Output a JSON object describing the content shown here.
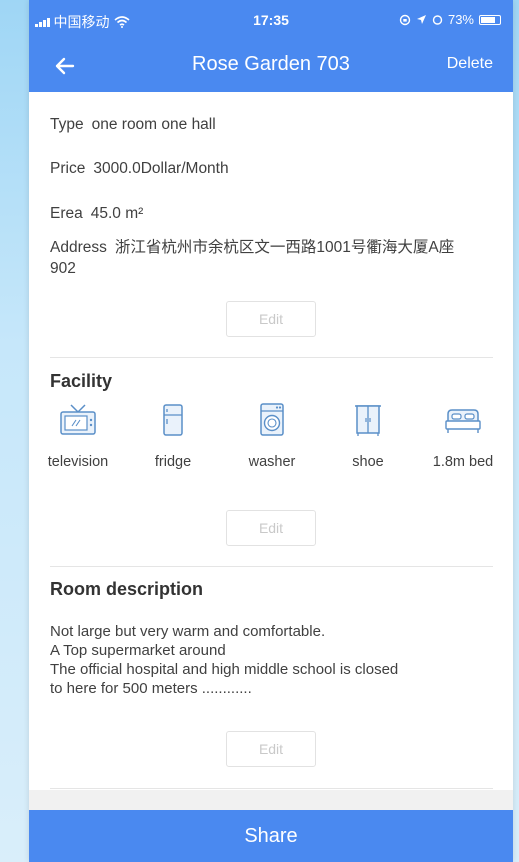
{
  "status_bar": {
    "carrier": "中国移动",
    "time": "17:35",
    "battery": "73%"
  },
  "nav": {
    "title": "Rose Garden 703",
    "delete_label": "Delete"
  },
  "info": {
    "type_label": "Type",
    "type_value": "one room one hall",
    "price_label": "Price",
    "price_value": "3000.0Dollar/Month",
    "area_label": "Erea",
    "area_value": "45.0 m²",
    "address_label": "Address",
    "address_value": "浙江省杭州市余杭区文一西路1001号衢海大厦A座902",
    "edit_label": "Edit"
  },
  "facility": {
    "title": "Facility",
    "items": [
      {
        "label": "television",
        "icon": "television-icon"
      },
      {
        "label": "fridge",
        "icon": "fridge-icon"
      },
      {
        "label": "washer",
        "icon": "washer-icon"
      },
      {
        "label": "shoe",
        "icon": "shoe-cabinet-icon"
      },
      {
        "label": "1.8m bed",
        "icon": "bed-icon"
      }
    ],
    "edit_label": "Edit"
  },
  "description": {
    "title": "Room description",
    "lines": [
      "Not large but very warm and comfortable.",
      "A Top supermarket around",
      "The official hospital and high middle school is closed",
      "to here for 500 meters ............"
    ],
    "edit_label": "Edit"
  },
  "share_label": "Share",
  "colors": {
    "accent": "#4a89f0",
    "icon": "#5a8fc8"
  }
}
